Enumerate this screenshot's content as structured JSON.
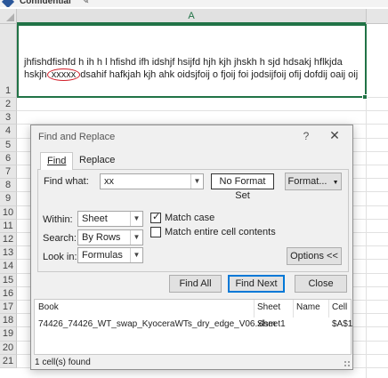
{
  "label_bar": {
    "label": "Confidential"
  },
  "sheet": {
    "column_header": "A",
    "row_numbers": [
      "1",
      "2",
      "3",
      "4",
      "5",
      "6",
      "7",
      "8",
      "9",
      "10",
      "11",
      "12",
      "13",
      "14",
      "15",
      "16",
      "17",
      "18",
      "19",
      "20",
      "21"
    ],
    "cell_a1": {
      "text_before": "jhfishdfishfd h ih h l hfishd ifh idshjf hsijfd hjh  kjh jhskh h   sjd hdsakj hflkjda hskjh  ",
      "highlight": "xxxxx",
      "text_after": " dsahif hafkjah kjh ahk   oidsjfoij o fjoij foi jodsijfoij ofij dofdij oaij oij"
    }
  },
  "dialog": {
    "title": "Find and Replace",
    "help_symbol": "?",
    "close_symbol": "✕",
    "tabs": [
      "Find",
      "Replace"
    ],
    "find_what_label": "Find what:",
    "find_what_value": "xx",
    "no_format_set": "No Format Set",
    "format_button": "Format...",
    "within_label": "Within:",
    "within_value": "Sheet",
    "search_label": "Search:",
    "search_value": "By Rows",
    "look_in_label": "Look in:",
    "look_in_value": "Formulas",
    "match_case_label": "Match case",
    "match_case_checked": true,
    "match_entire_label": "Match entire cell contents",
    "match_entire_checked": false,
    "options_button": "Options <<",
    "find_all_button": "Find All",
    "find_next_button": "Find Next",
    "close_button": "Close",
    "results": {
      "columns": [
        "Book",
        "Sheet",
        "Name",
        "Cell"
      ],
      "rows": [
        {
          "book": "74426_74426_WT_swap_KyoceraWTs_dry_edge_V06.xlsm",
          "sheet": "Sheet1",
          "name": "",
          "cell": "$A$1"
        }
      ]
    },
    "status": "1 cell(s) found"
  }
}
